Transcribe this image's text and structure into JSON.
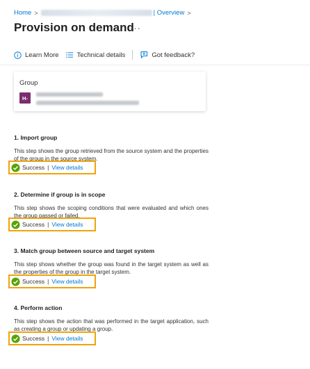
{
  "breadcrumb": {
    "home": "Home",
    "separator": ">",
    "current": "| Overview"
  },
  "page": {
    "title": "Provision on demand",
    "more": "···"
  },
  "toolbar": {
    "learn_more": "Learn More",
    "technical_details": "Technical details",
    "feedback": "Got feedback?"
  },
  "group_card": {
    "title": "Group",
    "avatar_initials": "H-"
  },
  "steps": [
    {
      "title": "1. Import group",
      "description": "This step shows the group retrieved from the source system and the properties of the group in the source system.",
      "status": "Success",
      "link": "View details"
    },
    {
      "title": "2. Determine if group is in scope",
      "description": "This step shows the scoping conditions that were evaluated and which ones the group passed or failed.",
      "status": "Success",
      "link": "View details"
    },
    {
      "title": "3. Match group between source and target system",
      "description": "This step shows whether the group was found in the target system as well as the properties of the group in the target system.",
      "status": "Success",
      "link": "View details"
    },
    {
      "title": "4. Perform action",
      "description": "This step shows the action that was performed in the target application, such as creating a group or updating a group.",
      "status": "Success",
      "link": "View details"
    }
  ],
  "colors": {
    "accent": "#0078d4",
    "success": "#57a300",
    "highlight": "#f0a30a",
    "avatar": "#7b2d6e"
  }
}
